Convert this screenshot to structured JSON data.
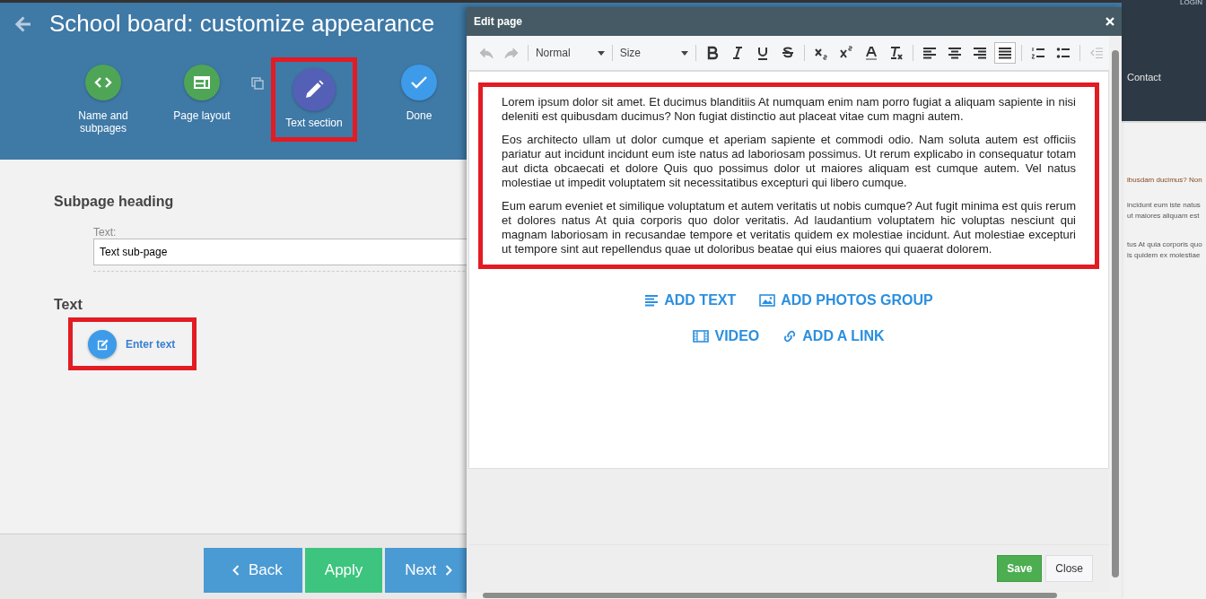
{
  "header": {
    "title": "School board: customize appearance"
  },
  "steps": [
    {
      "label": "Name and subpages",
      "color": "#4fa556",
      "selected": false,
      "highlighted": false
    },
    {
      "label": "Page layout",
      "color": "#4fa556",
      "selected": false,
      "highlighted": false
    },
    {
      "label": "Text section",
      "color": "#5360b5",
      "selected": true,
      "highlighted": true
    },
    {
      "label": "Done",
      "color": "#3d9be9",
      "selected": false,
      "highlighted": false
    }
  ],
  "form": {
    "heading": "Subpage heading",
    "field_label": "Text:",
    "field_value": "Text sub-page",
    "text_heading": "Text",
    "enter_text": {
      "label": "Enter text",
      "highlighted": true
    }
  },
  "footer_buttons": [
    {
      "label": "Back",
      "kind": "back"
    },
    {
      "label": "Apply",
      "kind": "apply"
    },
    {
      "label": "Next",
      "kind": "next"
    }
  ],
  "site_preview": {
    "login": "LOGIN",
    "nav": "Contact",
    "fragments": [
      "ibusdam ducimus? Non",
      "incidunt eum iste natus",
      "ut maiores aliquam est",
      "tus At quia corporis quo",
      "is quidem ex molestiae"
    ]
  },
  "dialog": {
    "title": "Edit page",
    "toolbar": [
      {
        "kind": "undo",
        "disabled": true,
        "selected": false
      },
      {
        "kind": "redo",
        "disabled": true,
        "selected": false
      },
      {
        "kind": "sep"
      },
      {
        "kind": "dropdown",
        "label": "Normal"
      },
      {
        "kind": "sep"
      },
      {
        "kind": "dropdown",
        "label": "Size"
      },
      {
        "kind": "sep"
      },
      {
        "kind": "bold",
        "disabled": false,
        "selected": false
      },
      {
        "kind": "italic",
        "disabled": false,
        "selected": false
      },
      {
        "kind": "underline",
        "disabled": false,
        "selected": false
      },
      {
        "kind": "strike",
        "disabled": false,
        "selected": false
      },
      {
        "kind": "sep"
      },
      {
        "kind": "subscript",
        "disabled": false,
        "selected": false
      },
      {
        "kind": "superscript",
        "disabled": false,
        "selected": false
      },
      {
        "kind": "color",
        "disabled": false,
        "selected": false
      },
      {
        "kind": "clear",
        "disabled": false,
        "selected": false
      },
      {
        "kind": "sep"
      },
      {
        "kind": "left",
        "disabled": false,
        "selected": false
      },
      {
        "kind": "center",
        "disabled": false,
        "selected": false
      },
      {
        "kind": "right",
        "disabled": false,
        "selected": false
      },
      {
        "kind": "justify",
        "disabled": false,
        "selected": true
      },
      {
        "kind": "sep"
      },
      {
        "kind": "ol",
        "disabled": false,
        "selected": false
      },
      {
        "kind": "ul",
        "disabled": false,
        "selected": false
      },
      {
        "kind": "sep"
      },
      {
        "kind": "outdent",
        "disabled": true,
        "selected": false
      }
    ],
    "content_highlighted": true,
    "paragraphs": [
      "Lorem ipsum dolor sit amet. Et ducimus blanditiis At numquam enim nam porro fugiat a aliquam sapiente in nisi deleniti est quibusdam ducimus? Non fugiat distinctio aut placeat vitae cum magni autem.",
      "Eos architecto ullam ut dolor cumque et aperiam sapiente et commodi odio. Nam soluta autem est officiis pariatur aut incidunt incidunt eum iste natus ad laboriosam possimus. Ut rerum explicabo in consequatur totam aut dicta obcaecati et dolore Quis quo possimus dolor ut maiores aliquam est cumque autem. Vel natus molestiae ut impedit voluptatem sit necessitatibus excepturi qui libero cumque.",
      "Eum earum eveniet et similique voluptatum et autem veritatis ut nobis cumque? Aut fugit minima est quis rerum et dolores natus At quia corporis quo dolor veritatis. Ad laudantium voluptatem hic voluptas nesciunt qui magnam laboriosam in recusandae tempore et veritatis quidem ex molestiae incidunt. Aut molestiae excepturi ut tempore sint aut repellendus quae ut doloribus beatae qui eius maiores qui quaerat dolorem."
    ],
    "add_rows": [
      [
        "ADD TEXT",
        "ADD PHOTOS GROUP"
      ],
      [
        "VIDEO",
        "ADD A LINK"
      ]
    ],
    "buttons": [
      {
        "label": "Save",
        "kind": "primary"
      },
      {
        "label": "Close",
        "kind": "default"
      }
    ]
  }
}
